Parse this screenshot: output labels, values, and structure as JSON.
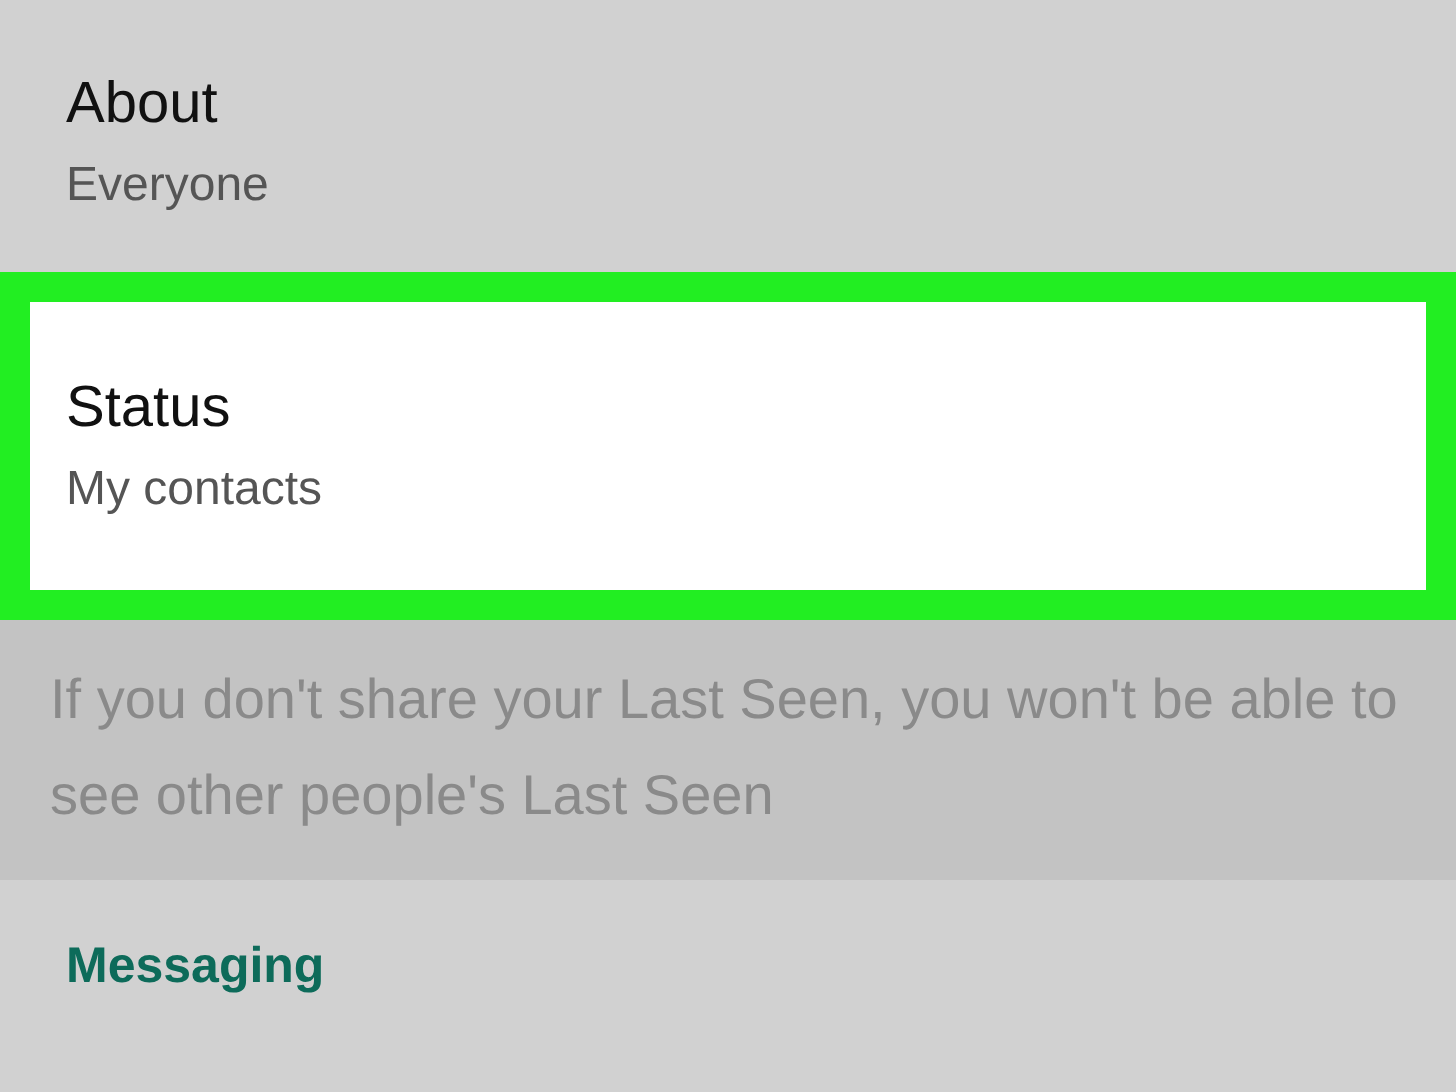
{
  "settings": [
    {
      "title": "About",
      "value": "Everyone",
      "highlighted": false
    },
    {
      "title": "Status",
      "value": "My contacts",
      "highlighted": true
    }
  ],
  "note": "If you don't share your Last Seen, you won't be able to see other people's Last Seen",
  "section_header": "Messaging"
}
